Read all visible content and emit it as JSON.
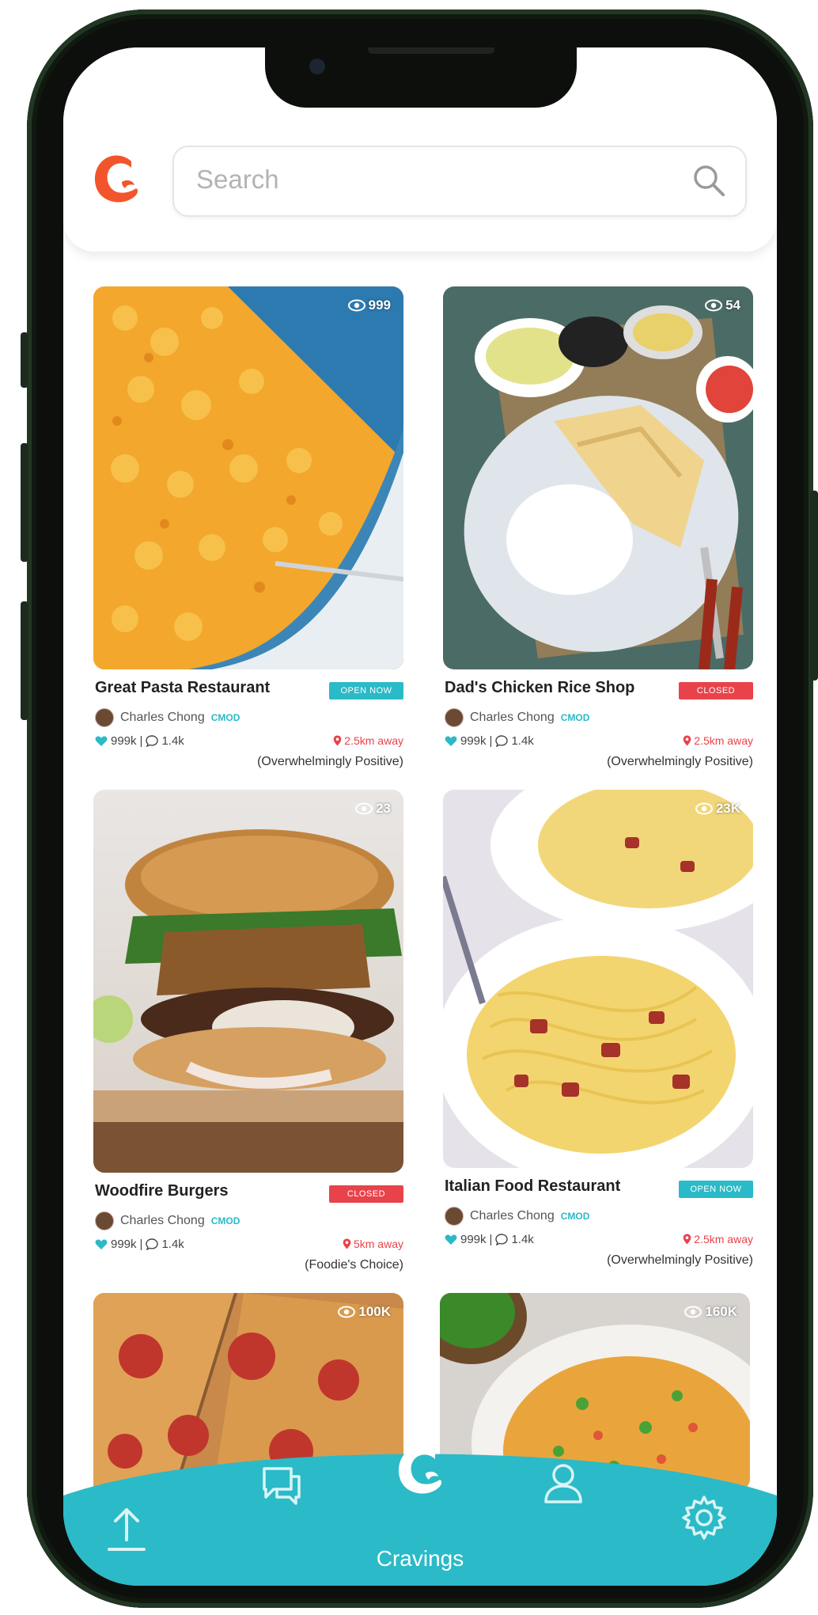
{
  "search": {
    "placeholder": "Search"
  },
  "restaurants": [
    {
      "name": "Great Pasta Restaurant",
      "status": "OPEN NOW",
      "views": "999",
      "author": "Charles Chong",
      "mod": "MOD",
      "likes": "999k",
      "comments": "1.4k",
      "distance": "2.5km away",
      "rating": "(Overwhelmingly Positive)"
    },
    {
      "name": "Dad's Chicken Rice Shop",
      "status": "CLOSED",
      "views": "54",
      "author": "Charles Chong",
      "mod": "MOD",
      "likes": "999k",
      "comments": "1.4k",
      "distance": "2.5km away",
      "rating": "(Overwhelmingly Positive)"
    },
    {
      "name": "Woodfire Burgers",
      "status": "CLOSED",
      "views": "23",
      "author": "Charles Chong",
      "mod": "MOD",
      "likes": "999k",
      "comments": "1.4k",
      "distance": "5km away",
      "rating": "(Foodie's Choice)"
    },
    {
      "name": "Italian Food Restaurant",
      "status": "OPEN NOW",
      "views": "23K",
      "author": "Charles Chong",
      "mod": "MOD",
      "likes": "999k",
      "comments": "1.4k",
      "distance": "2.5km away",
      "rating": "(Overwhelmingly Positive)"
    },
    {
      "views": "100K"
    },
    {
      "views": "160K"
    }
  ],
  "nav": {
    "active_label": "Cravings"
  },
  "colors": {
    "accent": "#2bbac7",
    "brand": "#f2552c",
    "closed": "#e8434b"
  },
  "icons": [
    "search-icon",
    "eye-icon",
    "heart-icon",
    "comment-icon",
    "location-pin-icon",
    "upload-icon",
    "chat-icon",
    "cravings-logo-icon",
    "profile-icon",
    "settings-icon"
  ]
}
